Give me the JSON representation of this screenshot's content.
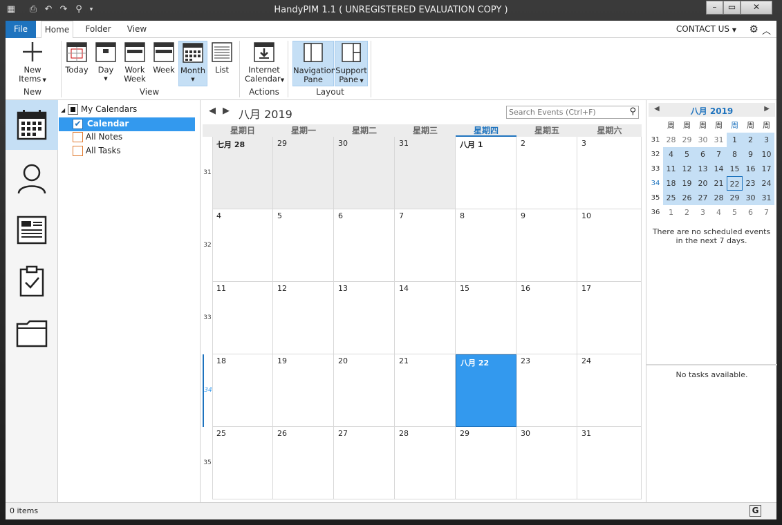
{
  "window": {
    "title": "HandyPIM 1.1 ( UNREGISTERED EVALUATION COPY )"
  },
  "tabs": {
    "file": "File",
    "home": "Home",
    "folder": "Folder",
    "view": "View"
  },
  "contact_us": "CONTACT US",
  "ribbon": {
    "new_items": [
      "New",
      "Items"
    ],
    "group_new": "New",
    "today": "Today",
    "day": "Day",
    "work_week": [
      "Work",
      "Week"
    ],
    "week": "Week",
    "month": "Month",
    "list": "List",
    "group_view": "View",
    "internet_calendar": [
      "Internet",
      "Calendar"
    ],
    "group_actions": "Actions",
    "navigation_pane": [
      "Navigation",
      "Pane"
    ],
    "support_pane": [
      "Support",
      "Pane"
    ],
    "group_layout": "Layout"
  },
  "folders": {
    "root": "My Calendars",
    "items": [
      "Calendar",
      "All Notes",
      "All Tasks"
    ]
  },
  "calendar": {
    "title": "八月 2019",
    "search_placeholder": "Search Events (Ctrl+F)",
    "weekdays": [
      "星期日",
      "星期一",
      "星期二",
      "星期三",
      "星期四",
      "星期五",
      "星期六"
    ],
    "week_numbers": [
      "31",
      "32",
      "33",
      "34",
      "35"
    ],
    "weeks": [
      [
        "七月 28",
        "29",
        "30",
        "31",
        "八月 1",
        "2",
        "3"
      ],
      [
        "4",
        "5",
        "6",
        "7",
        "8",
        "9",
        "10"
      ],
      [
        "11",
        "12",
        "13",
        "14",
        "15",
        "16",
        "17"
      ],
      [
        "18",
        "19",
        "20",
        "21",
        "八月 22",
        "23",
        "24"
      ],
      [
        "25",
        "26",
        "27",
        "28",
        "29",
        "30",
        "31"
      ]
    ]
  },
  "mini_calendar": {
    "title": "八月 2019",
    "weekday_header": [
      "周",
      "周",
      "周",
      "周",
      "周",
      "周",
      "周"
    ],
    "week_numbers": [
      "31",
      "32",
      "33",
      "34",
      "35",
      "36"
    ],
    "days": [
      [
        "28",
        "29",
        "30",
        "31",
        "1",
        "2",
        "3"
      ],
      [
        "4",
        "5",
        "6",
        "7",
        "8",
        "9",
        "10"
      ],
      [
        "11",
        "12",
        "13",
        "14",
        "15",
        "16",
        "17"
      ],
      [
        "18",
        "19",
        "20",
        "21",
        "22",
        "23",
        "24"
      ],
      [
        "25",
        "26",
        "27",
        "28",
        "29",
        "30",
        "31"
      ],
      [
        "1",
        "2",
        "3",
        "4",
        "5",
        "6",
        "7"
      ]
    ]
  },
  "events_message": "There are no scheduled events in the next 7 days.",
  "tasks_message": "No tasks available.",
  "status": {
    "items": "0 items"
  }
}
